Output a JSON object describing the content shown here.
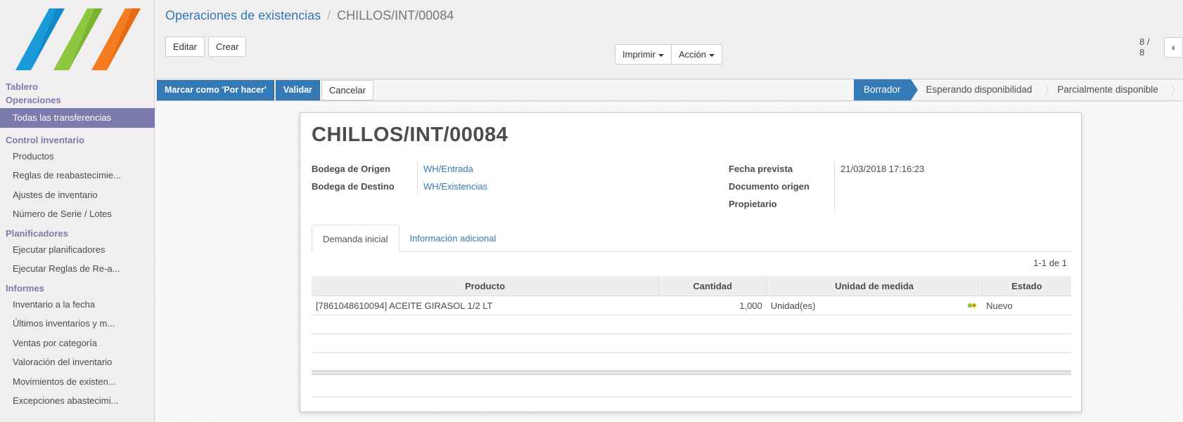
{
  "sidebar": {
    "top_headers": [
      "Tablero",
      "Operaciones"
    ],
    "active_item": "Todas las transferencias",
    "groups": [
      {
        "header": "Control inventario",
        "items": [
          "Productos",
          "Reglas de reabastecimie...",
          "Ajustes de inventario",
          "Número de Serie / Lotes"
        ]
      },
      {
        "header": "Planificadores",
        "items": [
          "Ejecutar planificadores",
          "Ejecutar Reglas de Re-a..."
        ]
      },
      {
        "header": "Informes",
        "items": [
          "Inventario a la fecha",
          "Últimos inventarios y m...",
          "Ventas por categoría",
          "Valoración del inventario",
          "Movimientos de existen...",
          "Excepciones abastecimi..."
        ]
      }
    ]
  },
  "breadcrumb": {
    "parent": "Operaciones de existencias",
    "separator": "/",
    "current": "CHILLOS/INT/00084"
  },
  "control_panel": {
    "edit_label": "Editar",
    "create_label": "Crear",
    "print_label": "Imprimir",
    "action_label": "Acción",
    "pager_value": "8 / 8"
  },
  "statusbar": {
    "buttons": {
      "mark_todo": "Marcar como 'Por hacer'",
      "validate": "Validar",
      "cancel": "Cancelar"
    },
    "stages": [
      {
        "label": "Borrador",
        "active": true
      },
      {
        "label": "Esperando disponibilidad",
        "active": false
      },
      {
        "label": "Parcialmente disponible",
        "active": false
      }
    ]
  },
  "record": {
    "title": "CHILLOS/INT/00084",
    "source_location_label": "Bodega de Origen",
    "source_location": "WH/Entrada",
    "dest_location_label": "Bodega de Destino",
    "dest_location": "WH/Existencias",
    "scheduled_date_label": "Fecha prevista",
    "scheduled_date": "21/03/2018 17:16:23",
    "origin_label": "Documento origen",
    "origin": "",
    "owner_label": "Propietario",
    "owner": ""
  },
  "tabs": {
    "initial_demand": "Demanda inicial",
    "additional_info": "Información adicional"
  },
  "list": {
    "pager": "1-1 de 1",
    "columns": {
      "product": "Producto",
      "quantity": "Cantidad",
      "uom": "Unidad de medida",
      "state": "Estado"
    },
    "rows": [
      {
        "product": "[7861048610094] ACEITE GIRASOL 1/2 LT",
        "quantity": "1,000",
        "uom": "Unidad(es)",
        "state": "Nuevo",
        "icon": "move-lines-icon"
      }
    ]
  },
  "colors": {
    "primary": "#337ab7",
    "sidebar_accent": "#7c7bad",
    "logo_blue": "#1a9bd7",
    "logo_green": "#8dc63f",
    "logo_orange": "#f47b20"
  }
}
